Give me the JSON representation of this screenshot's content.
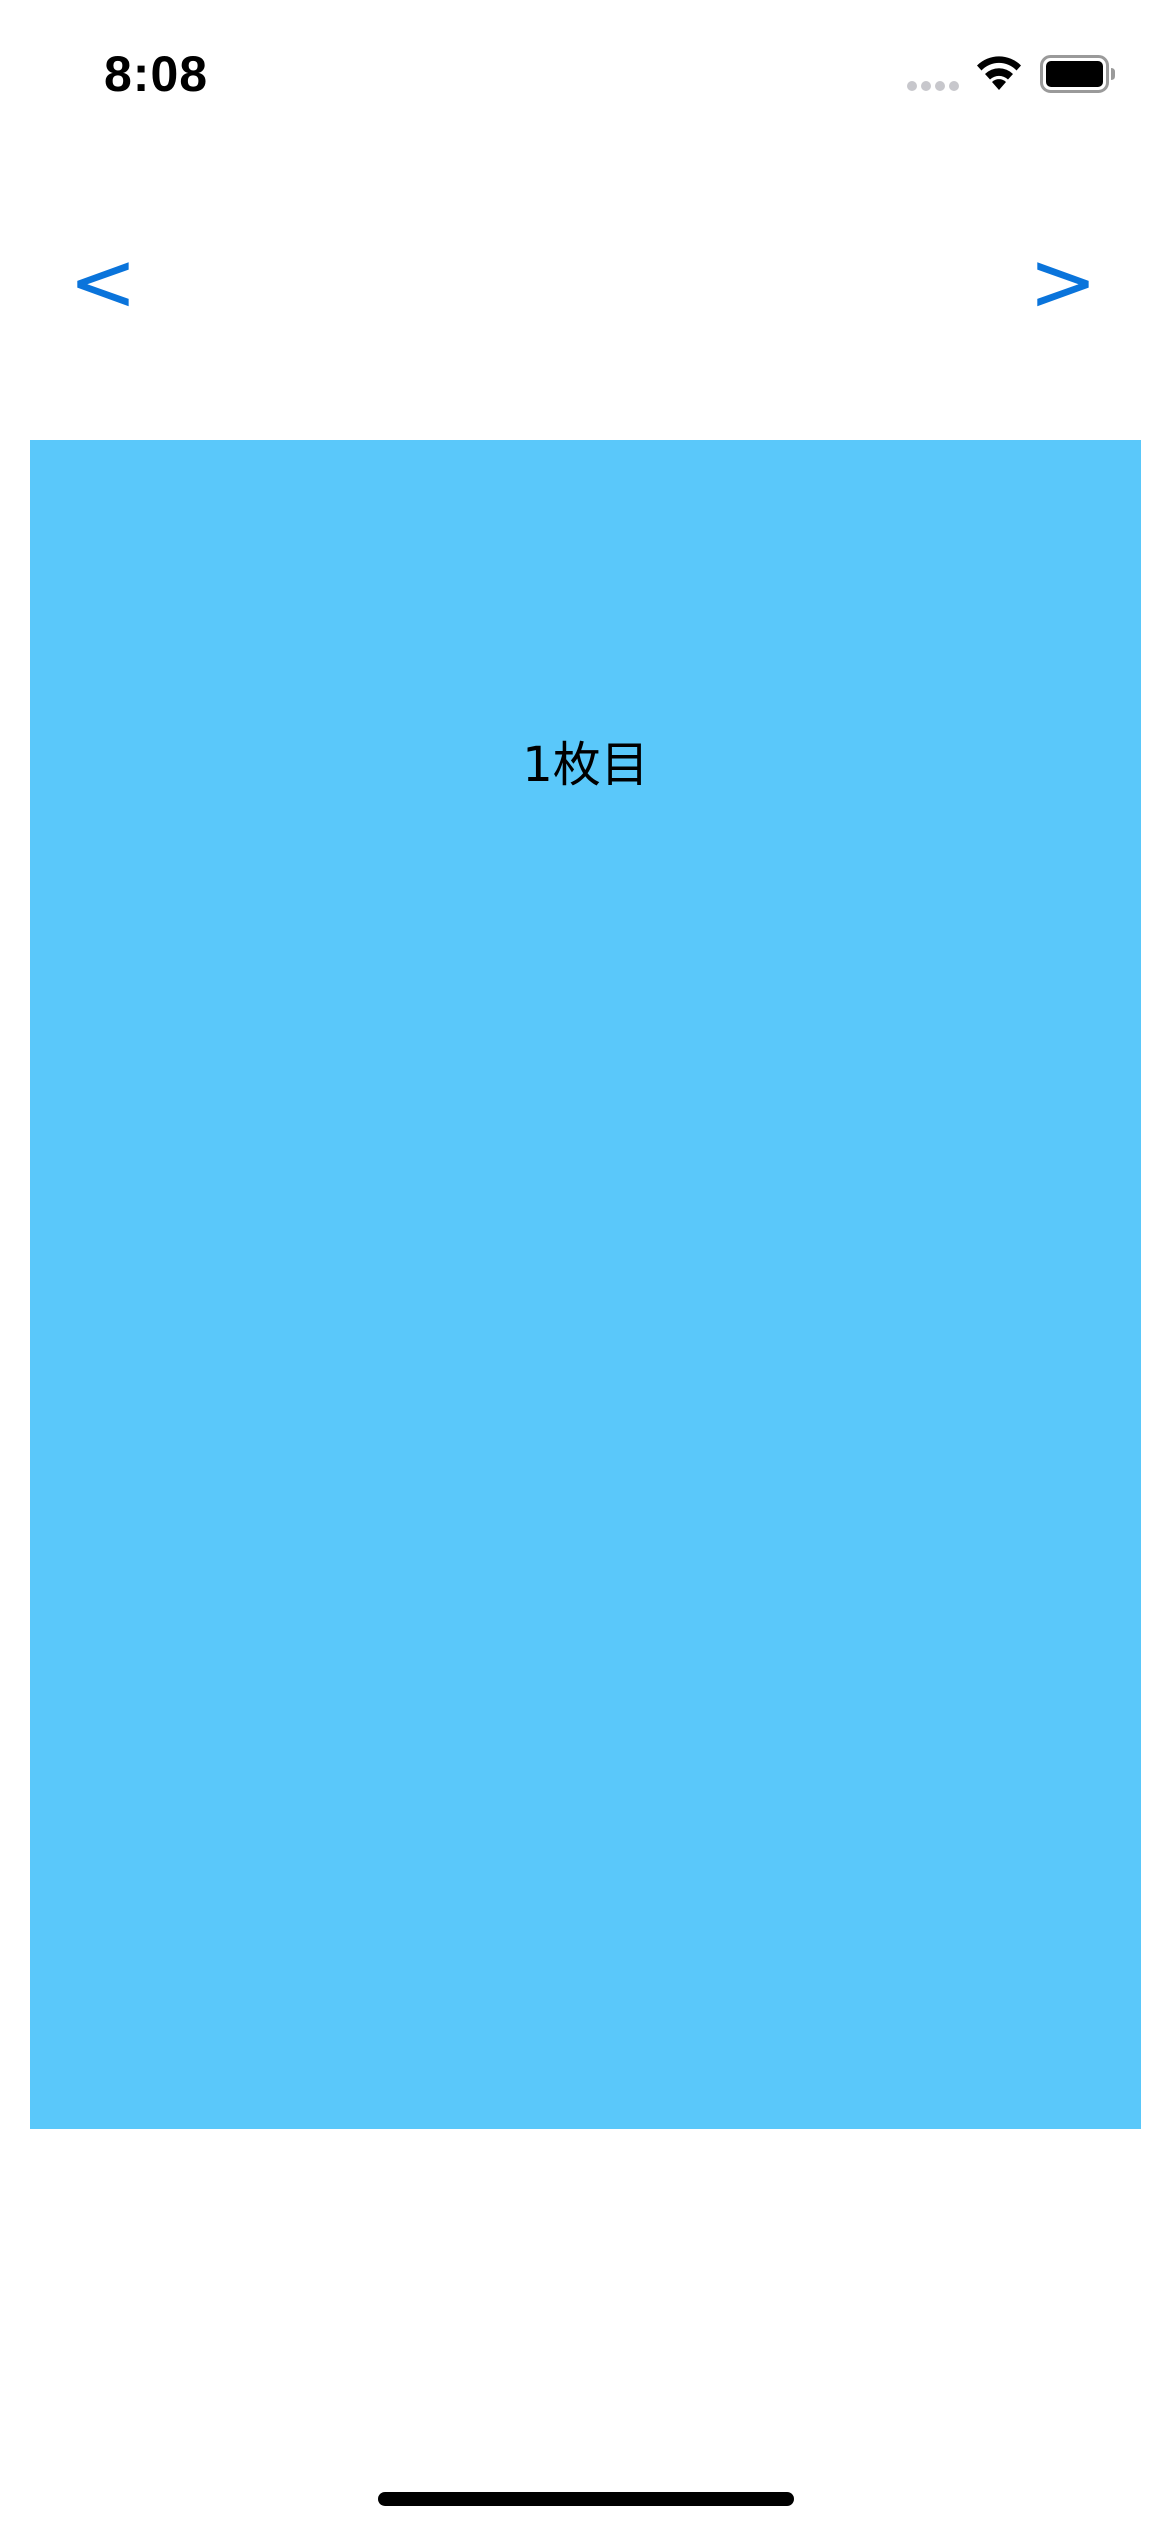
{
  "status_bar": {
    "time": "8:08",
    "signal_icon": "cellular-signal-dots-icon",
    "wifi_icon": "wifi-icon",
    "battery_icon": "battery-full-icon"
  },
  "nav": {
    "prev_label": "<",
    "next_label": ">",
    "accent_color": "#0a74db"
  },
  "page": {
    "label": "1枚目",
    "background_color": "#5ac8fa"
  }
}
